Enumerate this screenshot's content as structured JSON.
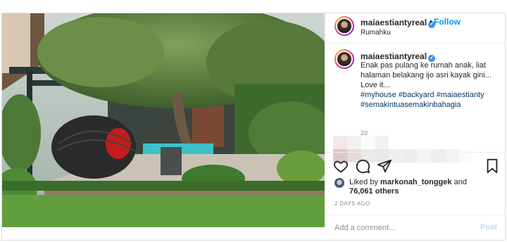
{
  "post": {
    "username": "maiaestiantyreal",
    "verified_icon": "verified-badge-icon",
    "follow_label": "Follow",
    "dot": "•",
    "location": "Rumahku",
    "caption_dot": ".",
    "caption_text": "Enak pas pulang ke rumah anak, liat halaman belakang ijo asri kayak gini... Love it...",
    "hashtags": [
      "#myhouse",
      "#backyard",
      "#maiaestianty",
      "#semakintuasemakinbahagia"
    ],
    "caption_time": "2d",
    "liked_by_prefix": "Liked by",
    "liked_by_user": "markonah_tonggek",
    "liked_by_and": "and",
    "likes_count": "76,061 others",
    "posted_ago": "2 DAYS AGO",
    "comment_placeholder": "Add a comment...",
    "post_label": "Post"
  },
  "icons": {
    "like": "heart-icon",
    "comment": "comment-bubble-icon",
    "share": "paper-plane-icon",
    "save": "bookmark-icon"
  },
  "colors": {
    "link_blue": "#0095f6",
    "hashtag": "#00376b",
    "muted": "#8e8e8e",
    "post_disabled": "#b2dffc"
  }
}
